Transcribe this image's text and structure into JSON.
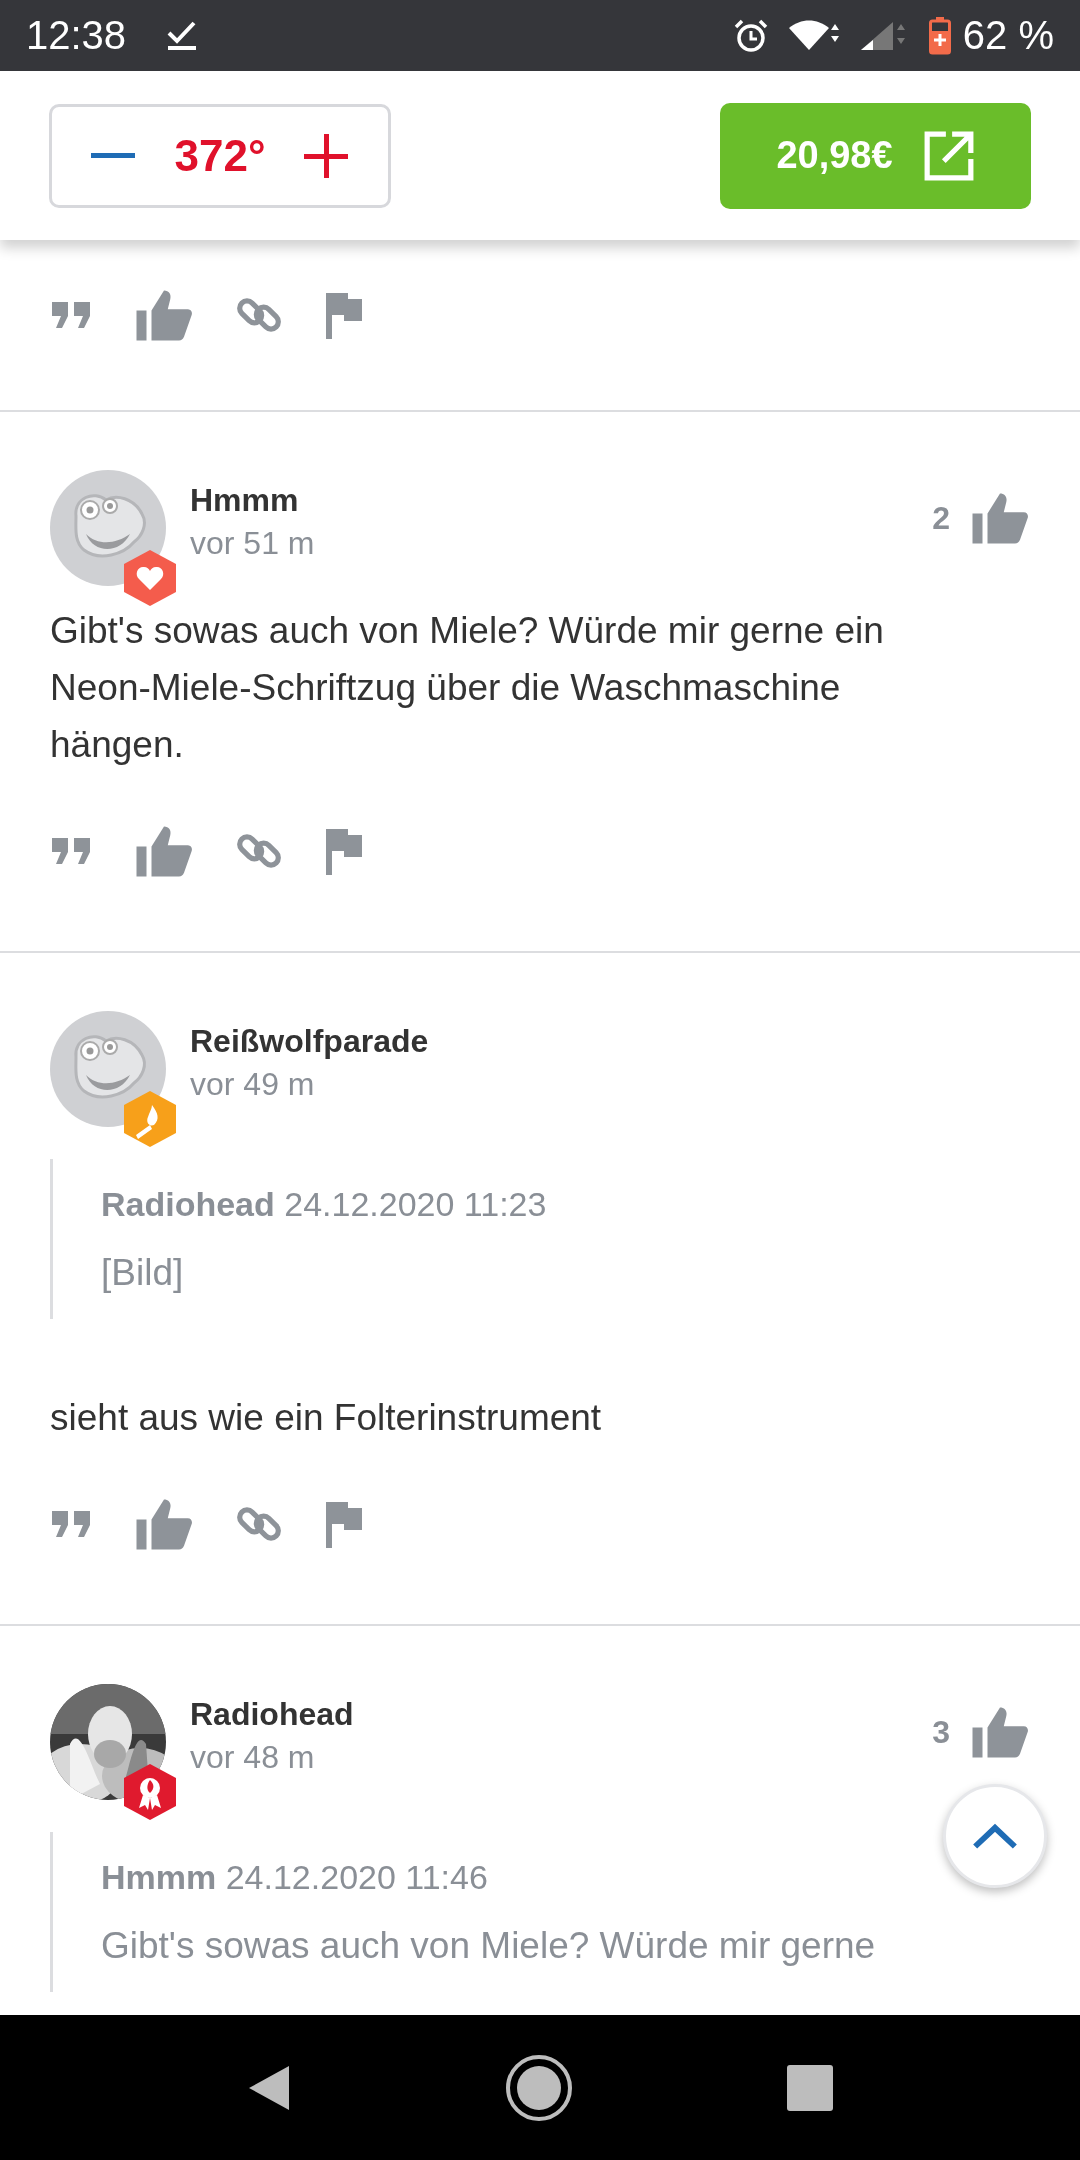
{
  "status_bar": {
    "time": "12:38",
    "battery": "62 %"
  },
  "header": {
    "temperature": "372°",
    "price": "20,98€"
  },
  "previous_comment": {
    "actions_visible": true
  },
  "comments": [
    {
      "author": "Hmmm",
      "time": "vor 51 m",
      "votes": "2",
      "text": "Gibt's sowas auch von Miele? Würde mir gerne ein Neon-Miele-Schriftzug über die Waschmaschine hängen.",
      "actions_visible": true
    },
    {
      "author": "Reißwolfparade",
      "time": "vor 49 m",
      "quote": {
        "author": "Radiohead",
        "date": "24.12.2020 11:23",
        "text": "[Bild]"
      },
      "text": "sieht aus wie ein Folterinstrument",
      "actions_visible": true
    },
    {
      "author": "Radiohead",
      "time": "vor 48 m",
      "votes": "3",
      "quote": {
        "author": "Hmmm",
        "date": "24.12.2020 11:46",
        "text": "Gibt's sowas auch von Miele? Würde mir gerne"
      }
    }
  ]
}
